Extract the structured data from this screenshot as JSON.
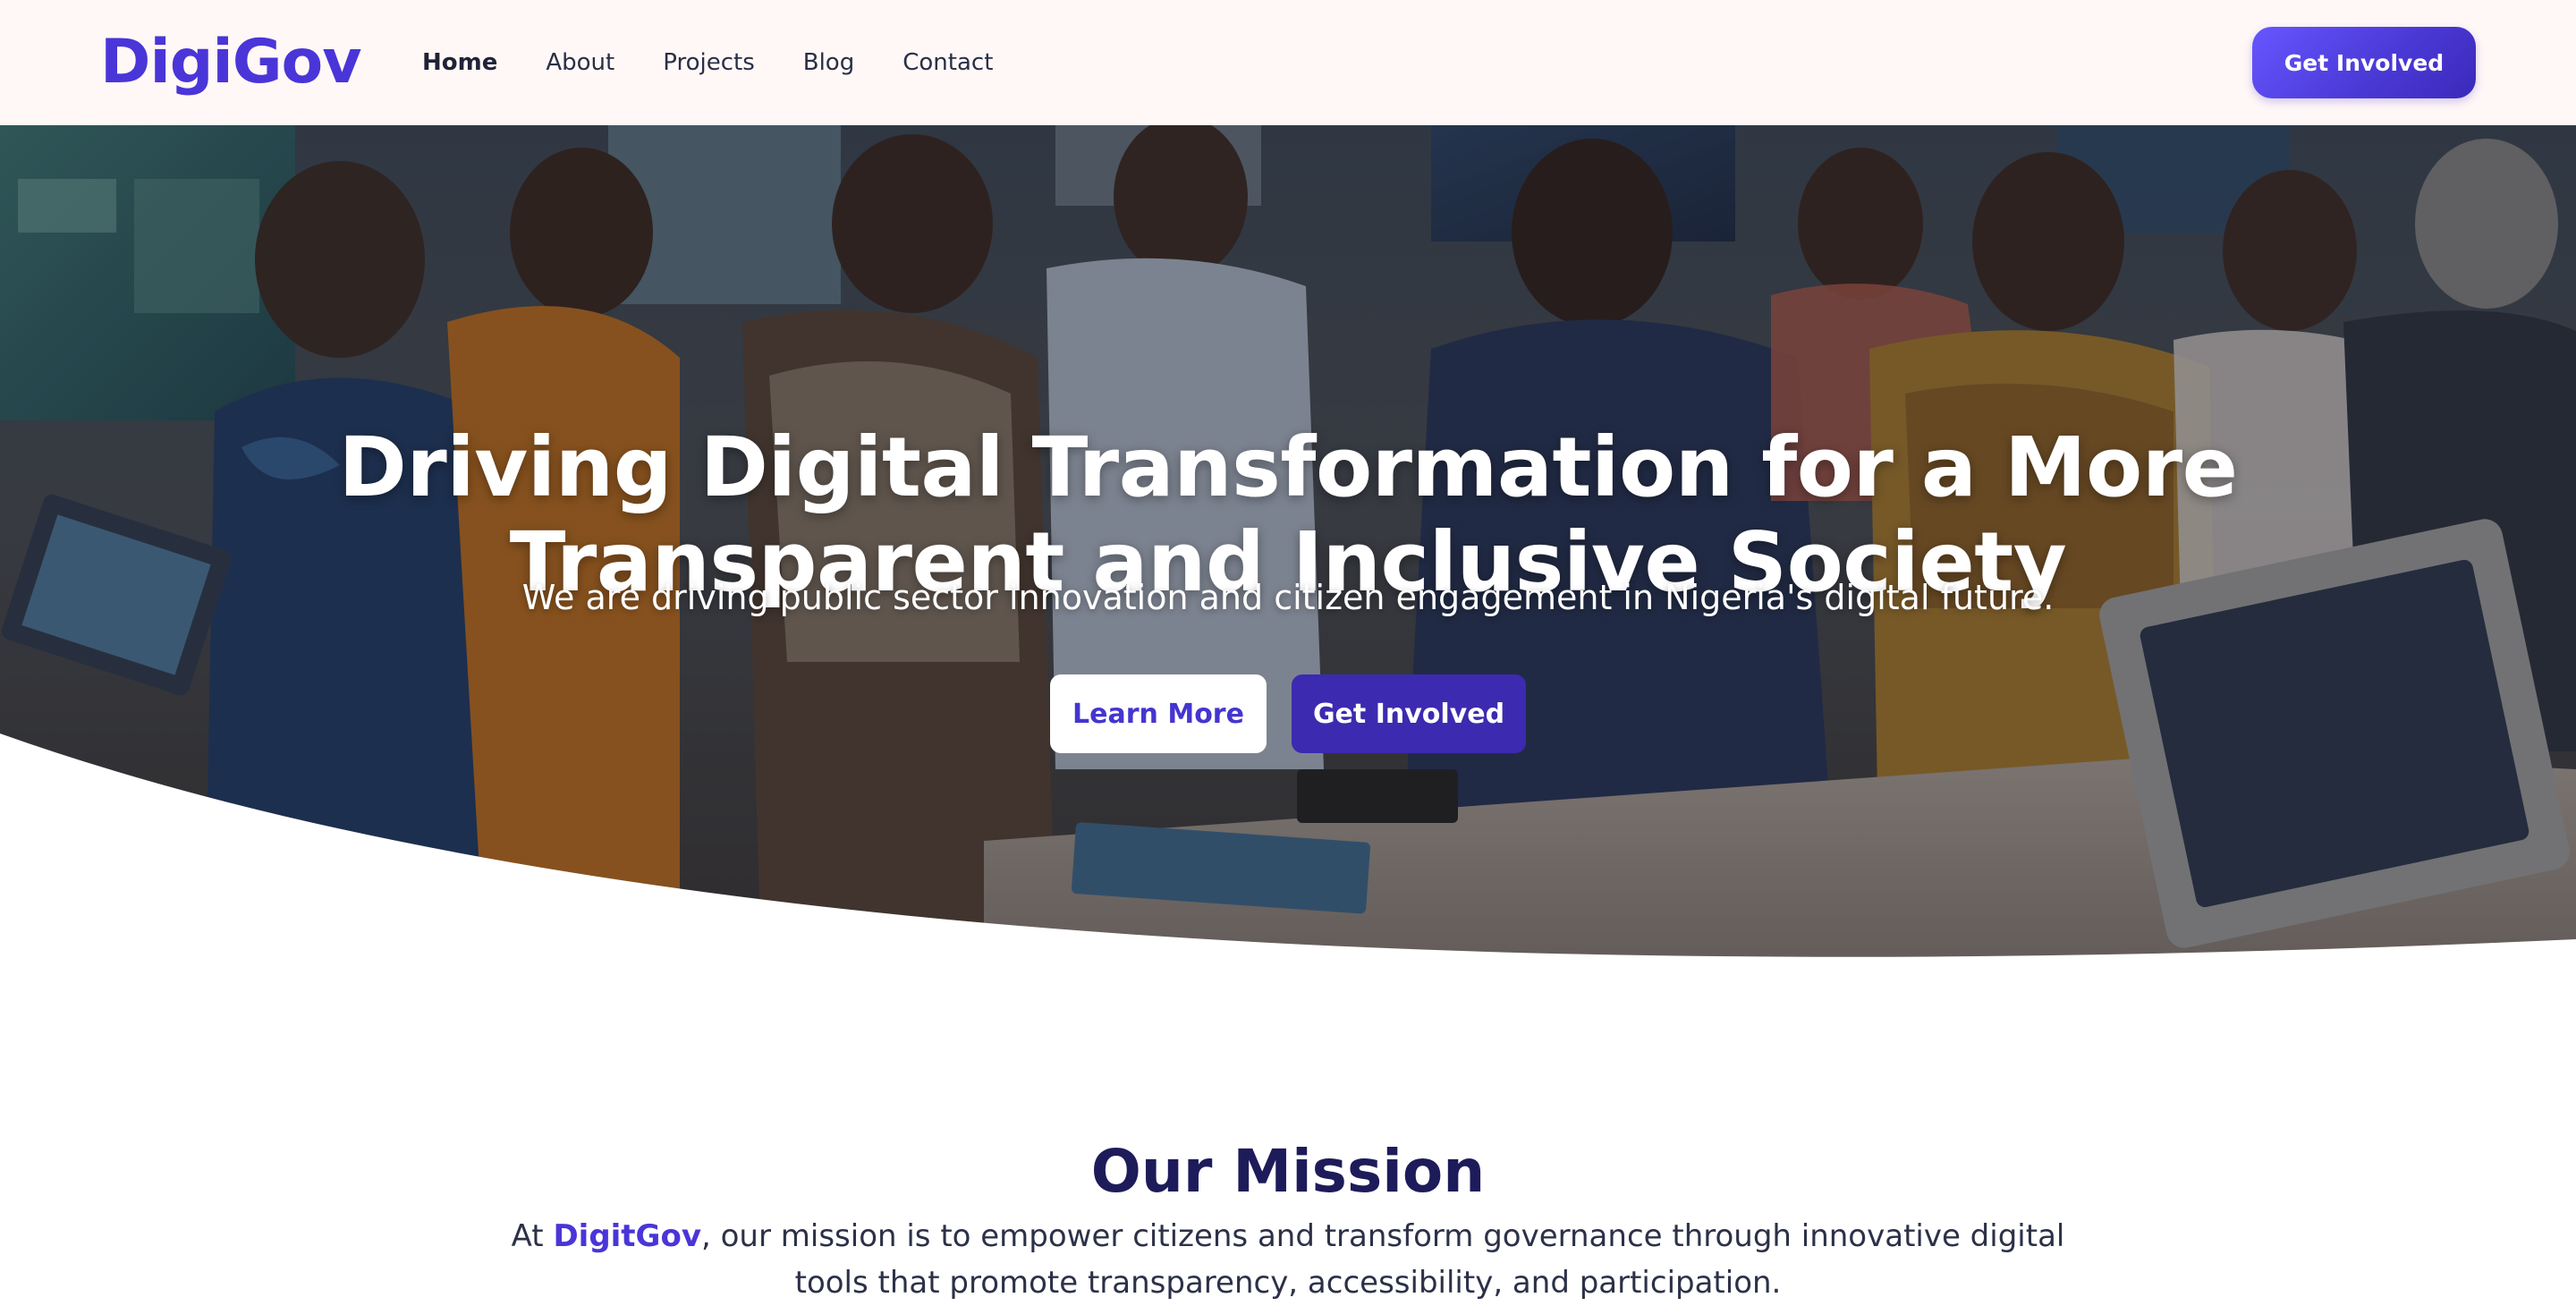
{
  "header": {
    "logo": "DigiGov",
    "nav": [
      {
        "label": "Home",
        "active": true
      },
      {
        "label": "About",
        "active": false
      },
      {
        "label": "Projects",
        "active": false
      },
      {
        "label": "Blog",
        "active": false
      },
      {
        "label": "Contact",
        "active": false
      }
    ],
    "cta_label": "Get Involved"
  },
  "hero": {
    "title_line1": "Driving Digital Transformation for a More",
    "title_line2": "Transparent and Inclusive Society",
    "subtitle": "We are driving public sector innovation and citizen engagement in Nigeria's digital future.",
    "learn_more_label": "Learn More",
    "get_involved_label": "Get Involved"
  },
  "mission": {
    "title": "Our Mission",
    "text_before": "At ",
    "brand": "DigitGov",
    "text_after": ", our mission is to empower citizens and transform governance through innovative digital tools that promote transparency, accessibility, and participation."
  },
  "colors": {
    "brand": "#4a35d8",
    "header_bg": "#fff8f7",
    "hero_overlay": "#1b1b22",
    "button_dark": "#3c2ab0",
    "heading_dark": "#1e1b5a"
  }
}
